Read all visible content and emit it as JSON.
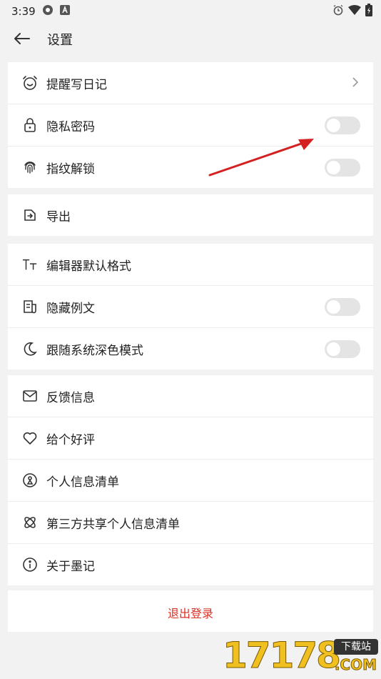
{
  "status_bar": {
    "time": "3:39"
  },
  "header": {
    "title": "设置"
  },
  "groups": [
    {
      "items": [
        {
          "label": "提醒写日记",
          "icon": "alarm-clock-icon",
          "control": "chevron"
        },
        {
          "label": "隐私密码",
          "icon": "lock-icon",
          "control": "toggle",
          "on": false
        },
        {
          "label": "指纹解锁",
          "icon": "fingerprint-icon",
          "control": "toggle",
          "on": false
        }
      ]
    },
    {
      "items": [
        {
          "label": "导出",
          "icon": "export-icon",
          "control": "none"
        }
      ]
    },
    {
      "items": [
        {
          "label": "编辑器默认格式",
          "icon": "text-format-icon",
          "control": "none"
        },
        {
          "label": "隐藏例文",
          "icon": "document-icon",
          "control": "toggle",
          "on": false
        },
        {
          "label": "跟随系统深色模式",
          "icon": "moon-icon",
          "control": "toggle",
          "on": false
        }
      ]
    },
    {
      "items": [
        {
          "label": "反馈信息",
          "icon": "mail-icon",
          "control": "none"
        },
        {
          "label": "给个好评",
          "icon": "heart-icon",
          "control": "none"
        },
        {
          "label": "个人信息清单",
          "icon": "person-info-icon",
          "control": "none"
        },
        {
          "label": "第三方共享个人信息清单",
          "icon": "share-icon",
          "control": "none"
        },
        {
          "label": "关于墨记",
          "icon": "info-icon",
          "control": "none"
        }
      ]
    }
  ],
  "logout": {
    "label": "退出登录"
  },
  "watermark": {
    "number": "17178",
    "badge": "下载站",
    "suffix": ".COM"
  },
  "colors": {
    "logout_text": "#d93025",
    "annotation_arrow": "#d42020",
    "toggle_off": "#e4e4e4"
  }
}
